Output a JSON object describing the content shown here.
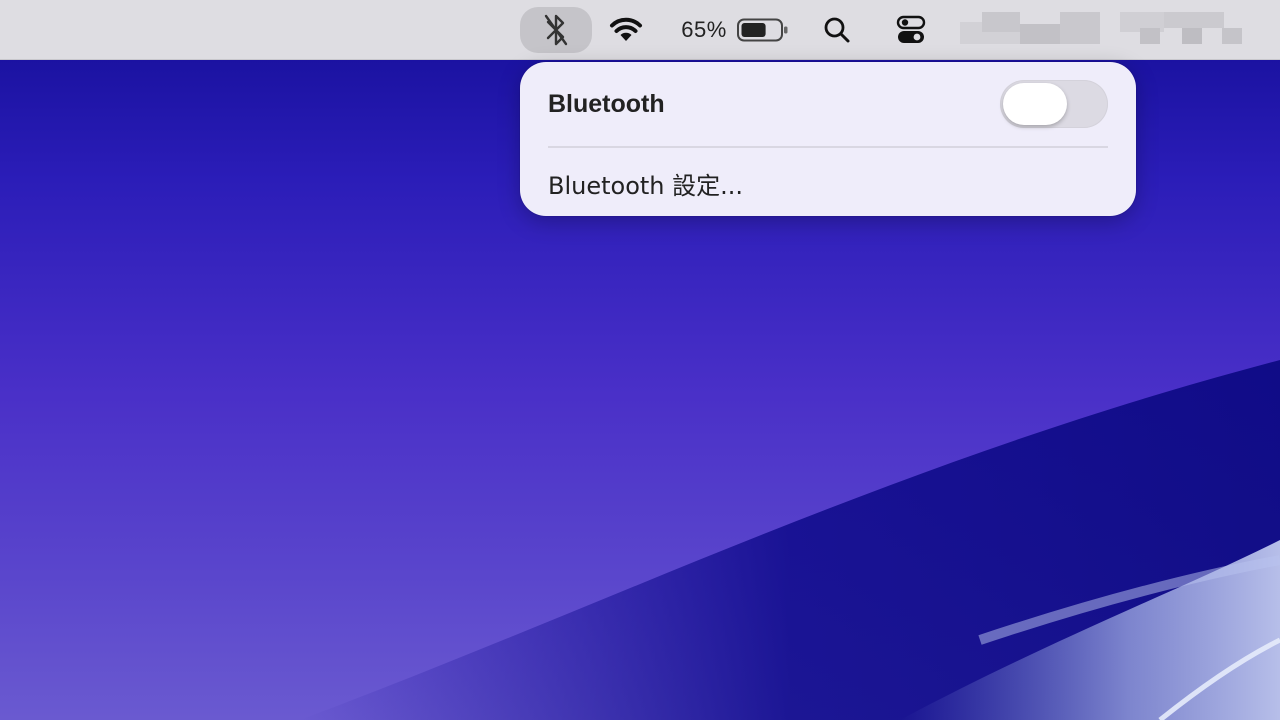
{
  "menubar": {
    "battery_percent": "65%",
    "battery_level": 0.65,
    "icons": [
      "bluetooth-icon",
      "wifi-icon",
      "battery-icon",
      "search-icon",
      "control-center-icon"
    ]
  },
  "bluetooth_menu": {
    "title": "Bluetooth",
    "toggle_on": false,
    "settings_label": "Bluetooth 設定..."
  },
  "colors": {
    "menubar_bg": "#dedde2",
    "popover_bg": "#efedfa",
    "wallpaper_top": "#130d96",
    "wallpaper_bottom": "#6a5ad0"
  }
}
